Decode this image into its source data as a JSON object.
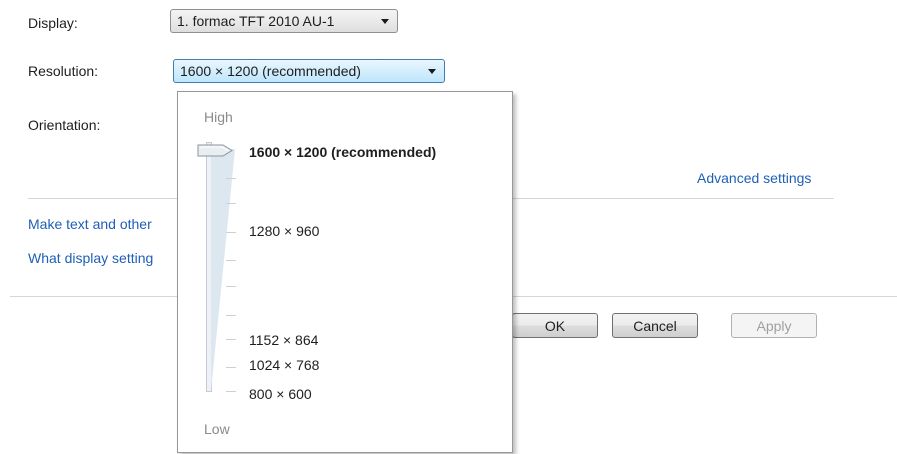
{
  "display": {
    "label": "Display:",
    "value": "1. formac TFT 2010 AU-1"
  },
  "resolution": {
    "label": "Resolution:",
    "value": "1600 × 1200 (recommended)"
  },
  "orientation": {
    "label": "Orientation:"
  },
  "advanced_settings": "Advanced settings",
  "links": {
    "make_text": "Make text and other",
    "what_display": "What display setting"
  },
  "buttons": {
    "ok": "OK",
    "cancel": "Cancel",
    "apply": "Apply"
  },
  "dropdown": {
    "high_label": "High",
    "low_label": "Low",
    "options": [
      {
        "label": "1600 × 1200 (recommended)",
        "selected": true
      },
      {
        "label": "1280 × 960",
        "selected": false
      },
      {
        "label": "1152 × 864",
        "selected": false
      },
      {
        "label": "1024 × 768",
        "selected": false
      },
      {
        "label": "800 × 600",
        "selected": false
      }
    ]
  },
  "colors": {
    "link": "#1f5fb5",
    "accent_border": "#3c7fb1"
  }
}
